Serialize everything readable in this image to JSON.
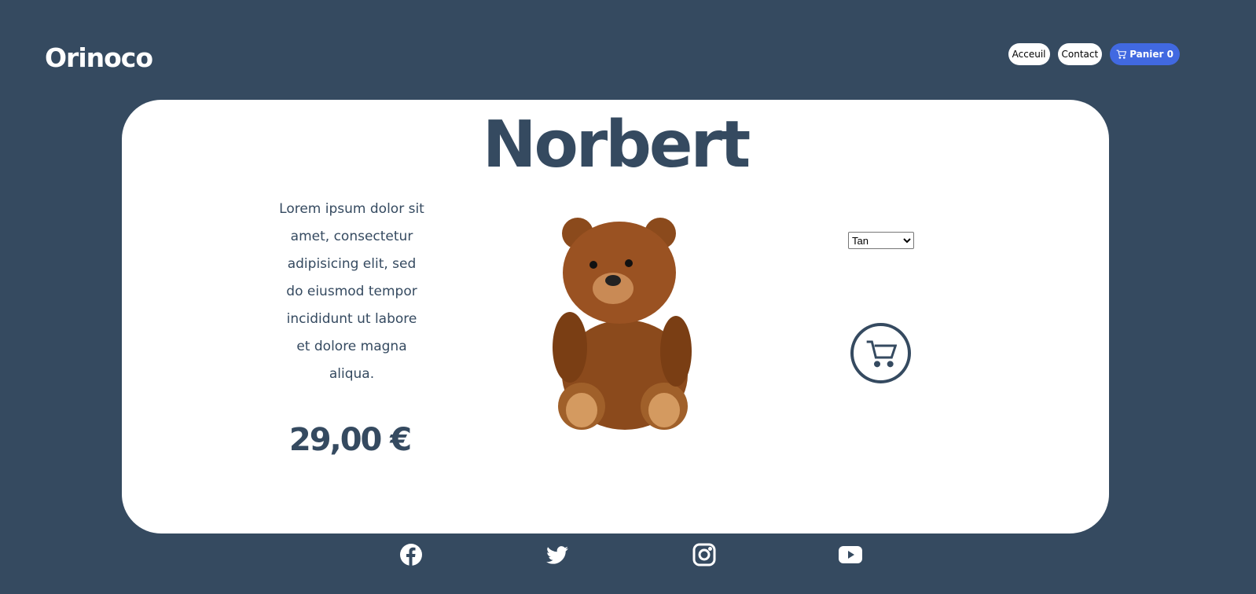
{
  "header": {
    "logo": "Orinoco",
    "nav": {
      "home": "Acceuil",
      "contact": "Contact",
      "cart": "Panier 0"
    }
  },
  "product": {
    "name": "Norbert",
    "description": "Lorem ipsum dolor sit amet, consectetur adipisicing elit, sed do eiusmod tempor incididunt ut labore et dolore magna aliqua.",
    "price": "29,00 €",
    "color_selected": "Tan"
  },
  "footer": {
    "icons": [
      "facebook-icon",
      "twitter-icon",
      "instagram-icon",
      "youtube-icon"
    ]
  },
  "colors": {
    "background": "#354a60",
    "accent": "#4169e1"
  }
}
